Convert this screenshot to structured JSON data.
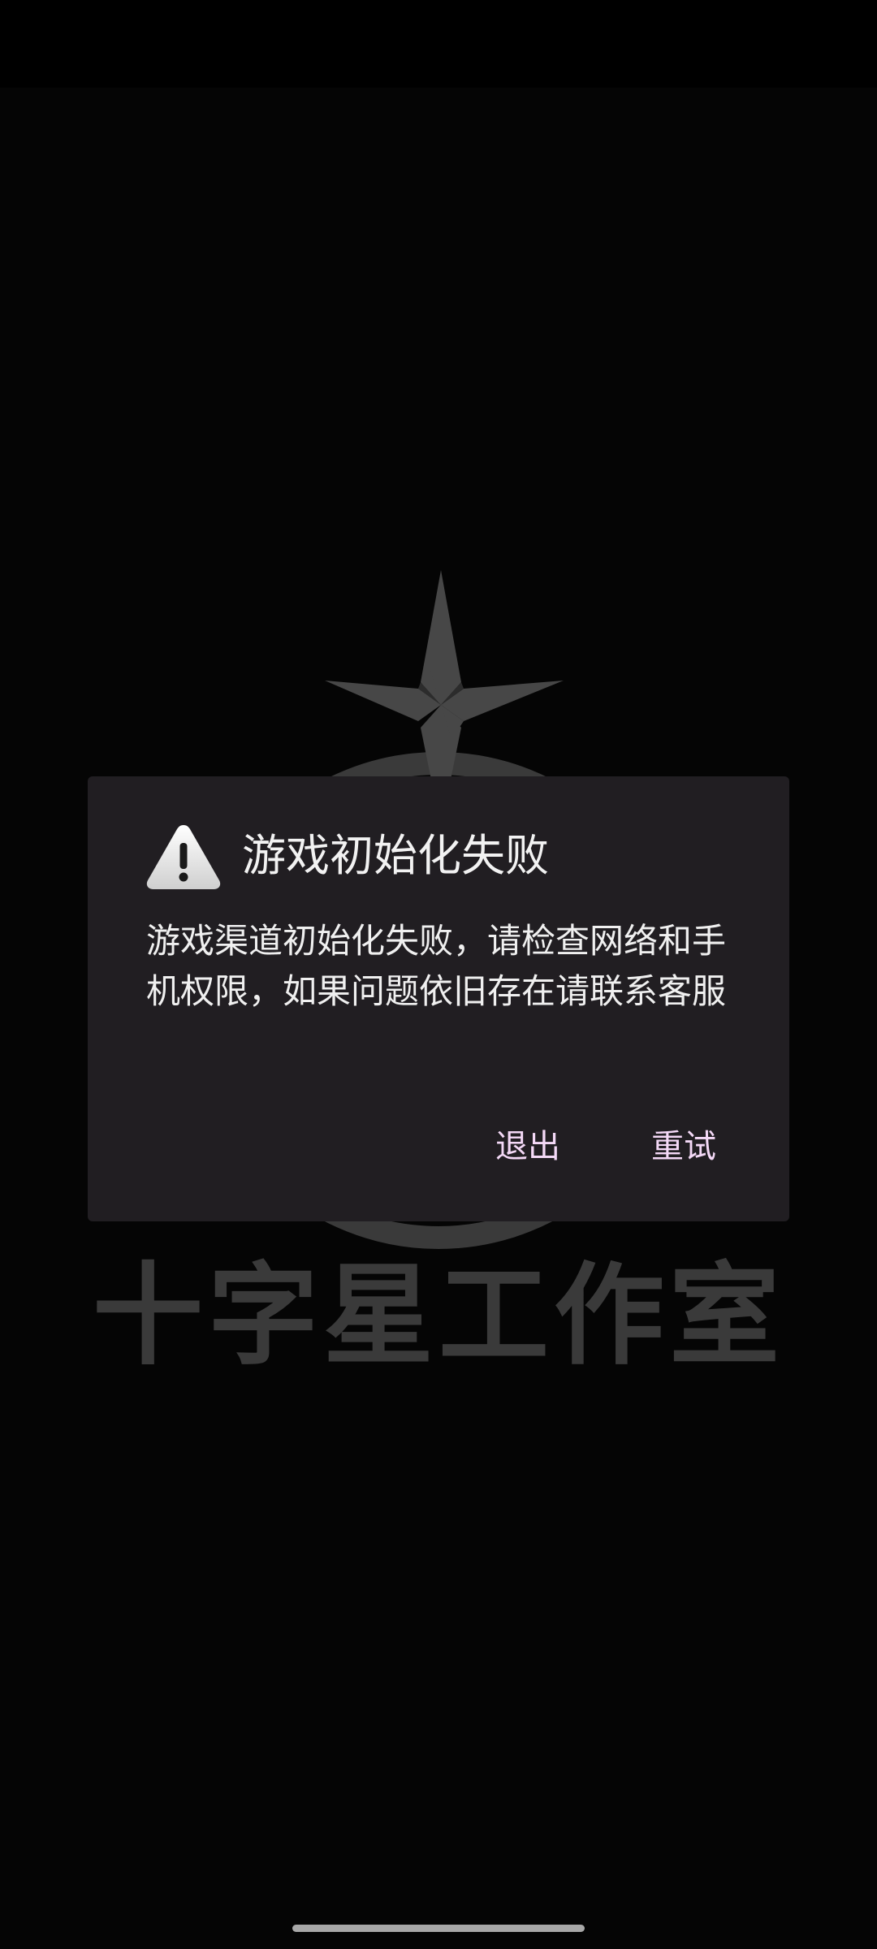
{
  "background": {
    "studio_name": "十字星工作室",
    "logo": "cross-star-logo"
  },
  "dialog": {
    "icon": "warning-icon",
    "title": "游戏初始化失败",
    "message": "游戏渠道初始化失败，请检查网络和手机权限，如果问题依旧存在请联系客服",
    "buttons": {
      "exit": "退出",
      "retry": "重试"
    }
  },
  "colors": {
    "background": "#050505",
    "dialog": "#211e22",
    "button_text": "#f4d9f7",
    "logo": "#3a3a3a"
  }
}
